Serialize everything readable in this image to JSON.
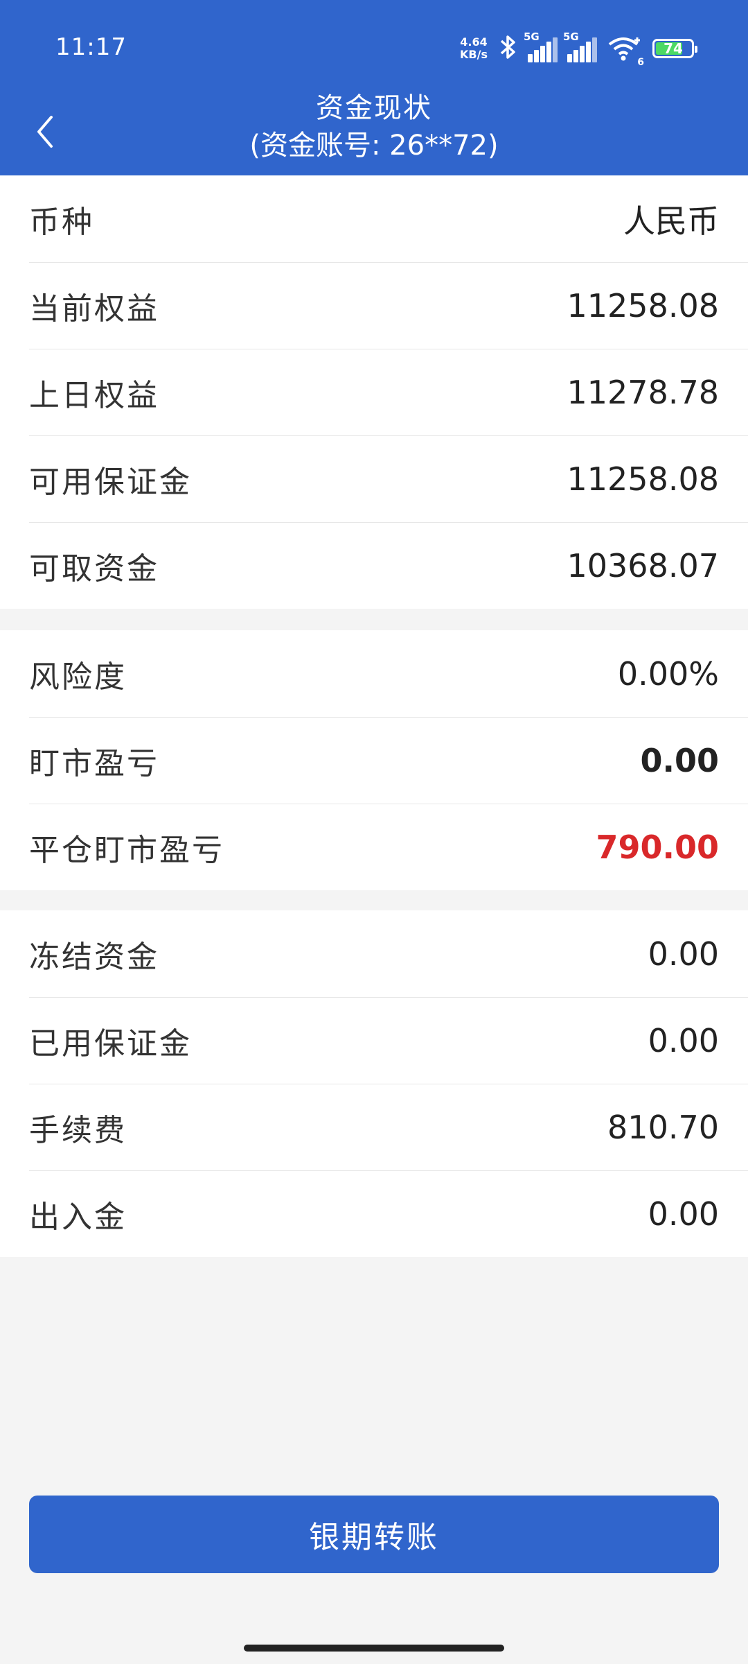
{
  "status": {
    "time": "11:17",
    "net_speed_value": "4.64",
    "net_speed_unit": "KB/s",
    "sim1_tag": "5G",
    "sim2_tag": "5G",
    "wifi_tag": "6",
    "battery": "74"
  },
  "header": {
    "title": "资金现状",
    "subtitle": "(资金账号: 26**72)"
  },
  "section1": [
    {
      "label": "币种",
      "value": "人民币"
    },
    {
      "label": "当前权益",
      "value": "11258.08"
    },
    {
      "label": "上日权益",
      "value": "11278.78"
    },
    {
      "label": "可用保证金",
      "value": "11258.08"
    },
    {
      "label": "可取资金",
      "value": "10368.07"
    }
  ],
  "section2": [
    {
      "label": "风险度",
      "value": "0.00%"
    },
    {
      "label": "盯市盈亏",
      "value": "0.00"
    },
    {
      "label": "平仓盯市盈亏",
      "value": "790.00"
    }
  ],
  "section3": [
    {
      "label": "冻结资金",
      "value": "0.00"
    },
    {
      "label": "已用保证金",
      "value": "0.00"
    },
    {
      "label": "手续费",
      "value": "810.70"
    },
    {
      "label": "出入金",
      "value": "0.00"
    }
  ],
  "footer": {
    "transfer_label": "银期转账"
  },
  "colors": {
    "brand": "#3065cc",
    "loss_red": "#d9282a",
    "background": "#f4f4f4"
  }
}
